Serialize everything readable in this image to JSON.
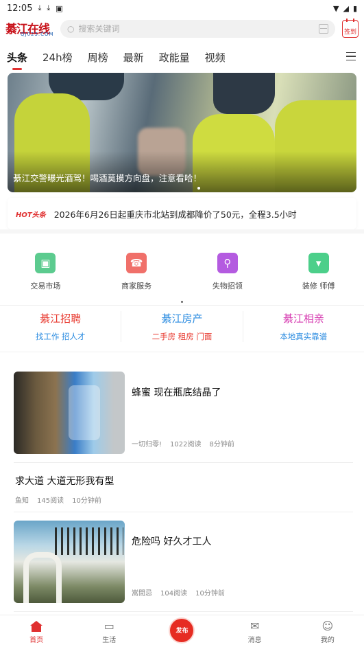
{
  "status_bar": {
    "time": "12:05"
  },
  "header": {
    "logo_text": "綦江在线",
    "logo_sub": "QJ023.COM",
    "search_placeholder": "搜索关键词",
    "signin_label": "签到"
  },
  "tabs": [
    {
      "label": "头条",
      "active": true
    },
    {
      "label": "24h榜"
    },
    {
      "label": "周榜"
    },
    {
      "label": "最新"
    },
    {
      "label": "政能量"
    },
    {
      "label": "视频"
    }
  ],
  "banner": {
    "caption": "綦江交警曝光酒驾！喝酒莫摸方向盘，注意看哈！"
  },
  "hot_news": {
    "badge": "HOT头条",
    "text": "2026年6月26日起重庆市北站到成都降价了50元，全程3.5小时"
  },
  "services": [
    {
      "label": "交易市场",
      "color": "#5ccb8f",
      "icon": "cart-icon"
    },
    {
      "label": "商家服务",
      "color": "#f0706a",
      "icon": "phone-icon"
    },
    {
      "label": "失物招领",
      "color": "#b45be0",
      "icon": "magnifier-icon"
    },
    {
      "label": "装修 师傅",
      "color": "#4ccf8a",
      "icon": "hammer-icon"
    }
  ],
  "channels": [
    {
      "title": "綦江招聘",
      "title_color": "#e8392f",
      "sub": "找工作  招人才",
      "sub_color": "#2a8be0"
    },
    {
      "title": "綦江房产",
      "title_color": "#2a8be0",
      "sub": "二手房 租房 门面",
      "sub_color": "#e8392f"
    },
    {
      "title": "綦江相亲",
      "title_color": "#d63ab0",
      "sub": "本地真实靠谱",
      "sub_color": "#2a8be0"
    }
  ],
  "feed": [
    {
      "title": "蜂蜜 现在瓶底结晶了",
      "author": "一切归零!",
      "reads": "1022阅读",
      "time": "8分钟前"
    },
    {
      "title": "求大道 大道无形我有型",
      "author": "鱼知",
      "reads": "145阅读",
      "time": "10分钟前"
    },
    {
      "title": "危险吗 好久才工人",
      "author": "嵩間忌",
      "reads": "104阅读",
      "time": "10分钟前"
    }
  ],
  "bottom_nav": [
    {
      "label": "首页",
      "active": true
    },
    {
      "label": "生活"
    },
    {
      "label": "发布"
    },
    {
      "label": "消息"
    },
    {
      "label": "我的"
    }
  ]
}
